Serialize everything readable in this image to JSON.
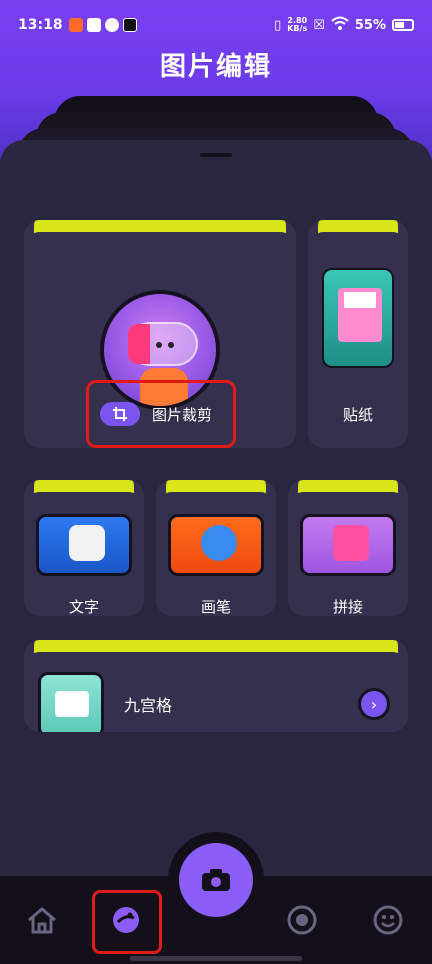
{
  "status_bar": {
    "time": "13:18",
    "net_speed_value": "2.80",
    "net_speed_unit": "KB/s",
    "battery": "55%"
  },
  "page_title": "图片编辑",
  "features": {
    "crop": {
      "label": "图片裁剪"
    },
    "sticker": {
      "label": "贴纸"
    },
    "text": {
      "label": "文字"
    },
    "brush": {
      "label": "画笔"
    },
    "splice": {
      "label": "拼接"
    },
    "grid": {
      "label": "九宫格"
    }
  },
  "colors": {
    "accent_purple": "#8b5cf6",
    "lime": "#d9e61a",
    "card_bg": "#35304d",
    "annotation_red": "#e11a1a"
  },
  "bottom_nav": {
    "items": [
      "home-icon",
      "edit-icon",
      "camera-icon",
      "record-icon",
      "smile-icon"
    ],
    "selected": "edit-icon"
  }
}
